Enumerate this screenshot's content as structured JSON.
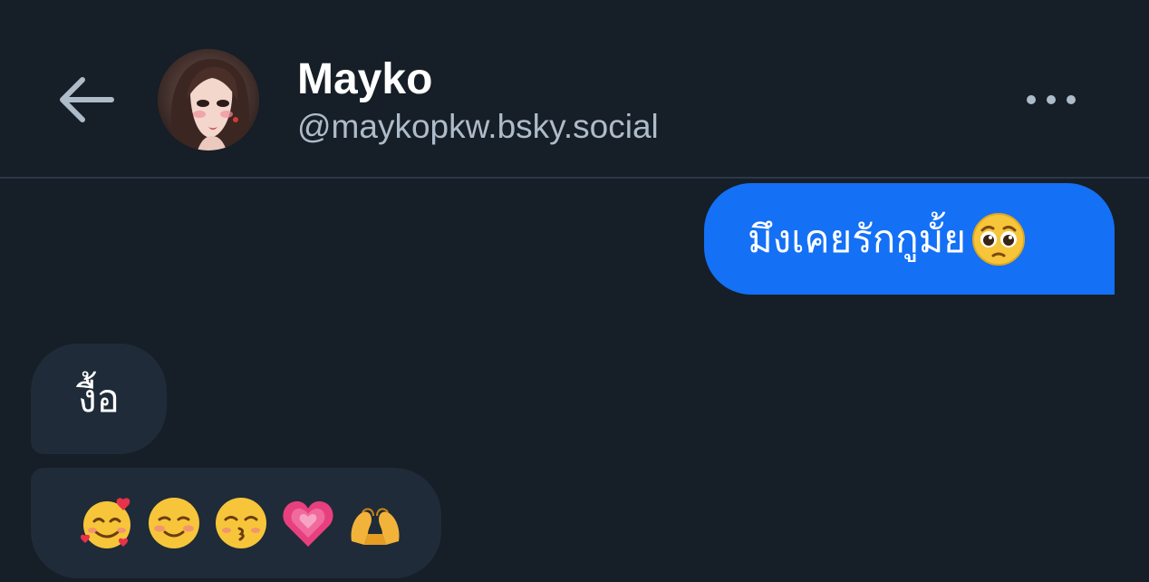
{
  "header": {
    "display_name": "Mayko",
    "handle": "@maykopkw.bsky.social"
  },
  "icons": {
    "back": "arrow-left-icon",
    "more": "ellipsis-icon",
    "avatar": "profile-avatar"
  },
  "colors": {
    "background": "#161e27",
    "divider": "#2b3947",
    "sent_bubble": "#1470f5",
    "received_bubble": "#1f2b38",
    "handle_text": "#aebbc9"
  },
  "messages": [
    {
      "direction": "sent",
      "text": "มึงเคยรักกูมั้ย",
      "emoji": [
        "pleading-face-emoji"
      ]
    },
    {
      "direction": "received",
      "text": "งื้อ"
    },
    {
      "direction": "received",
      "text": "",
      "emoji": [
        "smiling-face-with-hearts-emoji",
        "smiling-face-emoji",
        "kissing-face-smiling-eyes-emoji",
        "growing-heart-emoji",
        "heart-hands-emoji"
      ]
    }
  ]
}
